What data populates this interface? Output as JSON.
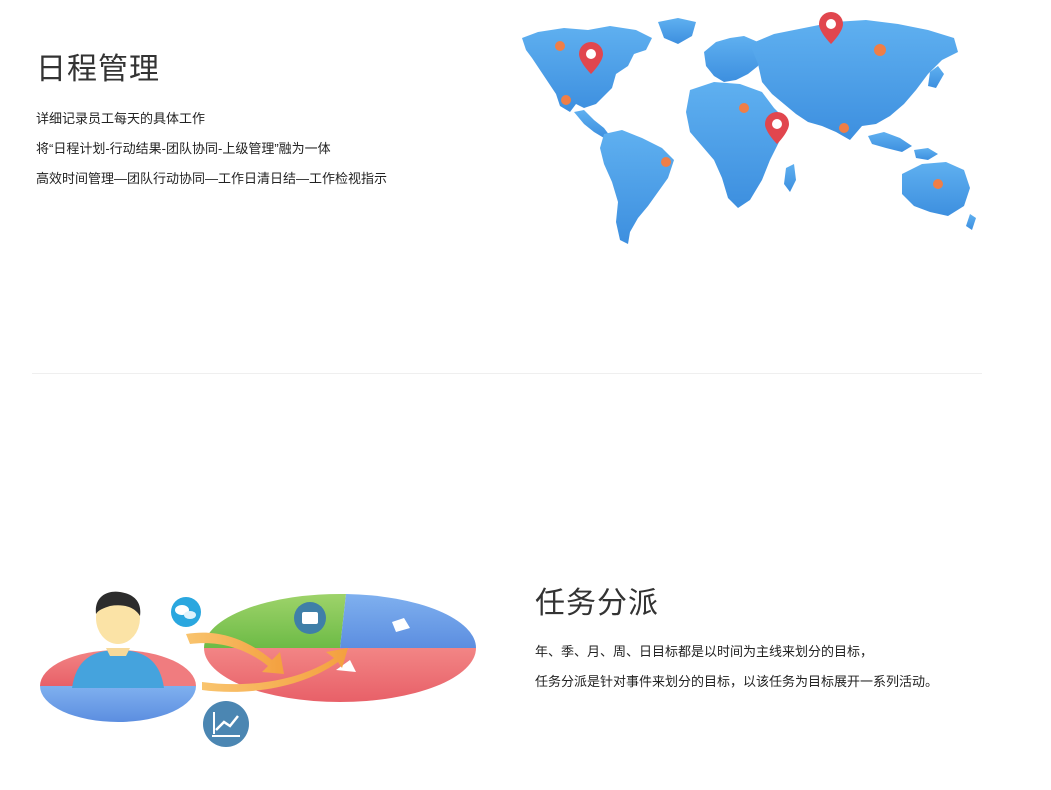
{
  "schedule_section": {
    "title": "日程管理",
    "lines": [
      "详细记录员工每天的具体工作",
      "将“日程计划-行动结果-团队协同-上级管理”融为一体",
      "高效时间管理—团队行动协同—工作日清日结—工作检视指示"
    ],
    "illustration_icon": "world-map-icon",
    "map_color": "#4aa0e8",
    "pin_color": "#e1464e",
    "dot_color": "#ef7e47"
  },
  "task_section": {
    "title": "任务分派",
    "lines": [
      "年、季、月、周、日目标都是以时间为主线来划分的目标，",
      "任务分派是针对事件来划分的目标，以该任务为目标展开一系列活动。"
    ],
    "illustration_icon": "task-assignment-icon",
    "pie_colors": {
      "green": "#7cc856",
      "blue": "#6f9fe6",
      "red": "#ef6f73"
    },
    "arrow_color": "#f7ae52"
  }
}
